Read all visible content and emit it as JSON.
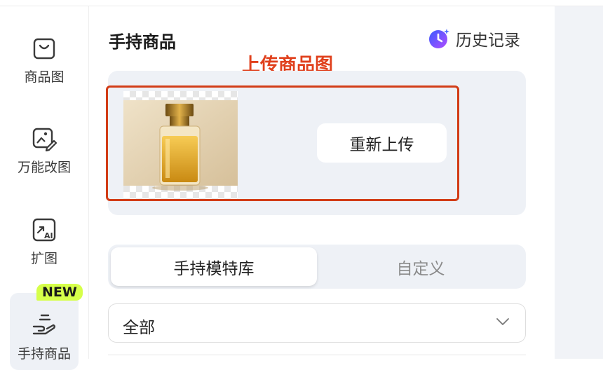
{
  "sidebar": {
    "items": [
      {
        "label": "商品图",
        "icon": "shopping-bag-icon"
      },
      {
        "label": "万能改图",
        "icon": "image-edit-icon"
      },
      {
        "label": "扩图",
        "icon": "ai-expand-icon"
      },
      {
        "label": "手持商品",
        "icon": "hand-holding-icon",
        "badge": "NEW",
        "active": true
      }
    ]
  },
  "header": {
    "title": "手持商品",
    "history_label": "历史记录",
    "history_icon": "history-moon-icon"
  },
  "annotation": {
    "text": "上传商品图",
    "color": "#e0401c"
  },
  "upload": {
    "reupload_label": "重新上传",
    "thumbnail": "perfume-bottle-product-image"
  },
  "tabs": [
    {
      "label": "手持模特库",
      "active": true
    },
    {
      "label": "自定义",
      "active": false
    }
  ],
  "filter": {
    "selected": "全部",
    "icon": "chevron-down-icon"
  },
  "colors": {
    "accent_badge": "#d6ff4a",
    "annotation_red": "#d23c16",
    "panel_bg": "#eef1f6"
  }
}
